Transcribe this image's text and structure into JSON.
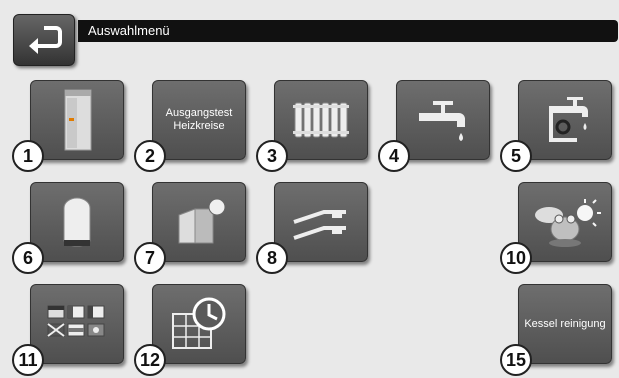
{
  "header": {
    "title": "Auswahlmenü"
  },
  "tiles": [
    {
      "id": "1",
      "number": "1",
      "label": "",
      "icon": "boiler-icon"
    },
    {
      "id": "2",
      "number": "2",
      "label": "Ausgangstest Heizkreise",
      "icon": ""
    },
    {
      "id": "3",
      "number": "3",
      "label": "",
      "icon": "radiator-icon"
    },
    {
      "id": "4",
      "number": "4",
      "label": "",
      "icon": "tap-icon"
    },
    {
      "id": "5",
      "number": "5",
      "label": "",
      "icon": "circulation-tap-icon"
    },
    {
      "id": "6",
      "number": "6",
      "label": "",
      "icon": "buffer-tank-icon"
    },
    {
      "id": "7",
      "number": "7",
      "label": "",
      "icon": "solar-collector-icon"
    },
    {
      "id": "8",
      "number": "8",
      "label": "",
      "icon": "differential-control-icon"
    },
    {
      "id": "10",
      "number": "10",
      "label": "",
      "icon": "weather-frog-icon"
    },
    {
      "id": "11",
      "number": "11",
      "label": "",
      "icon": "language-flags-icon"
    },
    {
      "id": "12",
      "number": "12",
      "label": "",
      "icon": "calendar-clock-icon"
    },
    {
      "id": "15",
      "number": "15",
      "label": "Kessel reinigung",
      "icon": ""
    }
  ]
}
